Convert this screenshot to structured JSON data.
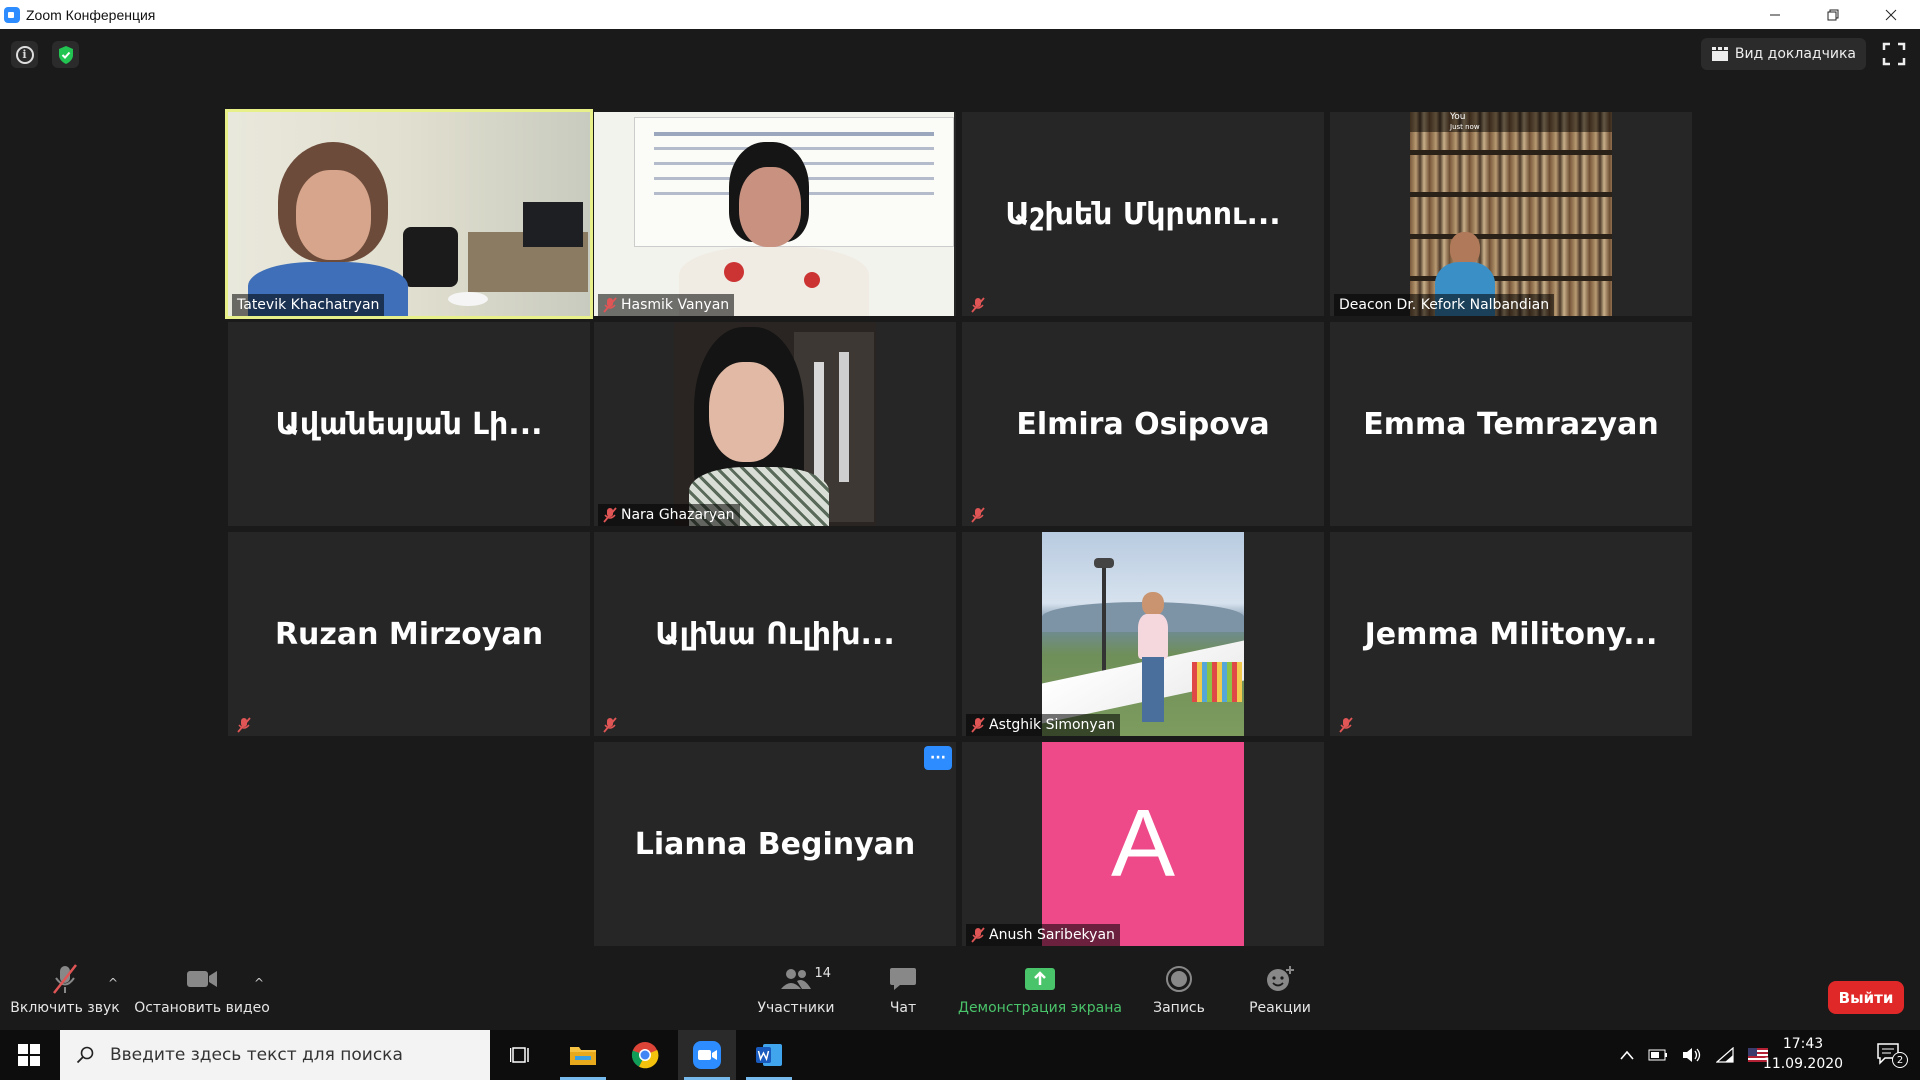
{
  "window": {
    "title": "Zoom Конференция"
  },
  "top": {
    "speaker_view_label": "Вид докладчика"
  },
  "participants": [
    {
      "name": "Tatevik Khachatryan",
      "type": "video",
      "muted": false,
      "active": true
    },
    {
      "name": "Hasmik Vanyan",
      "type": "video",
      "muted": true
    },
    {
      "name": "Աշխեն Մկրտու...",
      "type": "name",
      "muted": true
    },
    {
      "name": "Deacon Dr. Kefork Nalbandian",
      "type": "video",
      "muted": false
    },
    {
      "name": "Ավանեսյան Լի...",
      "type": "name",
      "muted": false
    },
    {
      "name": "Nara Ghazaryan",
      "type": "video",
      "muted": true
    },
    {
      "name": "Elmira Osipova",
      "type": "name",
      "muted": true
    },
    {
      "name": "Emma Temrazyan",
      "type": "name",
      "muted": false
    },
    {
      "name": "Ruzan Mirzoyan",
      "type": "name",
      "muted": true
    },
    {
      "name": "Ալինա Ուլիխ...",
      "type": "name",
      "muted": true
    },
    {
      "name": "Astghik Simonyan",
      "type": "video",
      "muted": true
    },
    {
      "name": "Jemma Militony...",
      "type": "name",
      "muted": true
    },
    {
      "name": "Lianna Beginyan",
      "type": "name",
      "muted": false,
      "more_button": "···"
    },
    {
      "name": "Anush Saribekyan",
      "type": "avatar",
      "muted": true,
      "avatar_letter": "A",
      "avatar_color": "#ee4a8a"
    }
  ],
  "deacon_overlay": {
    "you": "You",
    "sub": "Just now"
  },
  "toolbar": {
    "unmute_label": "Включить звук",
    "stop_video_label": "Остановить видео",
    "participants_label": "Участники",
    "participants_count": "14",
    "chat_label": "Чат",
    "share_label": "Демонстрация экрана",
    "record_label": "Запись",
    "reactions_label": "Реакции",
    "leave_label": "Выйти"
  },
  "taskbar": {
    "search_placeholder": "Введите здесь текст для поиска",
    "time": "17:43",
    "date": "11.09.2020",
    "notifications_count": "2"
  },
  "colors": {
    "accent_green": "#4ac46a",
    "leave_red": "#e02828",
    "active_speaker": "#e8f08a",
    "zoom_blue": "#2d8cff"
  }
}
